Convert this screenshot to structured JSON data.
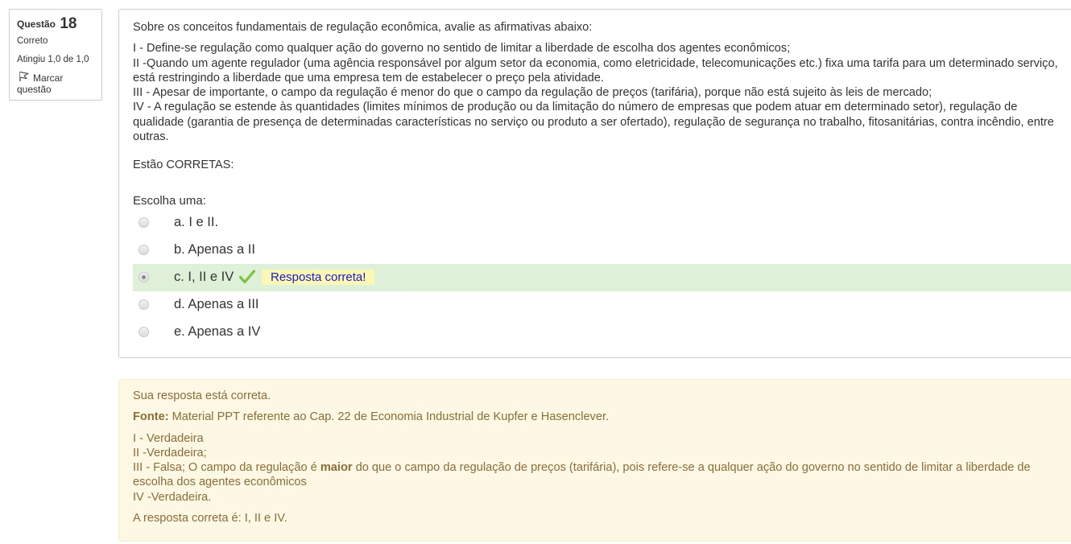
{
  "info": {
    "question_label": "Questão",
    "question_number": "18",
    "state": "Correto",
    "grade": "Atingiu 1,0 de 1,0",
    "flag_label_line1": "Marcar",
    "flag_label_line2": "questão",
    "flag_icon": "flag-icon"
  },
  "question": {
    "intro": "Sobre os conceitos fundamentais de regulação econômica, avalie as afirmativas abaixo:",
    "statements": [
      "I - Define-se regulação como qualquer ação do governo no  sentido de limitar a liberdade de escolha dos agentes  econômicos;",
      "II -Quando um agente regulador (uma agência  responsável por algum setor da economia, como eletricidade,  telecomunicações etc.) fixa uma tarifa para um determinado  serviço, está restringindo a liberdade que uma empresa tem de  estabelecer o preço pela atividade.",
      "III - Apesar de importante, o campo da regulação é  menor do que o campo da regulação de preços (tarifária), porque não está sujeito às leis de mercado;",
      "IV - A regulação se estende às quantidades (limites mínimos de  produção ou da limitação do número de empresas que podem  atuar em determinado setor), regulação de qualidade (garantia  de presença de determinadas características no serviço ou  produto a ser ofertado), regulação de segurança no trabalho, fitosanitárias, contra incêndio, entre outras."
    ],
    "correct_label": "Estão CORRETAS:",
    "prompt": "Escolha uma:",
    "answers": [
      {
        "label": "a. I e II.",
        "selected": false
      },
      {
        "label": "b. Apenas a II",
        "selected": false
      },
      {
        "label": "c. I, II e IV",
        "selected": true
      },
      {
        "label": "d. Apenas a III",
        "selected": false
      },
      {
        "label": "e. Apenas a IV",
        "selected": false
      }
    ],
    "inline_feedback": "Resposta correta!",
    "check_icon": "check-icon",
    "colors": {
      "correct_row_bg": "#dff0d8",
      "inline_feedback_bg": "#fcf8b4",
      "inline_feedback_text": "#1a1ac8",
      "check": "#7cc23e"
    }
  },
  "feedback": {
    "status": "Sua resposta está correta.",
    "source_label": "Fonte:",
    "source_text": " Material PPT referente ao Cap. 22 de Economia Industrial de Kupfer e Hasenclever.",
    "line1": "I - Verdadeira",
    "line2": "II -Verdadeira;",
    "line3_pre": "III - Falsa; O campo da regulação é ",
    "line3_bold": "maior",
    "line3_post": " do que o campo da regulação de preços (tarifária), pois refere-se a qualquer ação do governo no  sentido de limitar a liberdade de escolha dos agentes  econômicos",
    "line4": "IV -Verdadeira.",
    "right_answer": "A resposta correta é: I, II e IV.",
    "colors": {
      "bg": "#fcf8e3",
      "text": "#8a6d3b"
    }
  }
}
